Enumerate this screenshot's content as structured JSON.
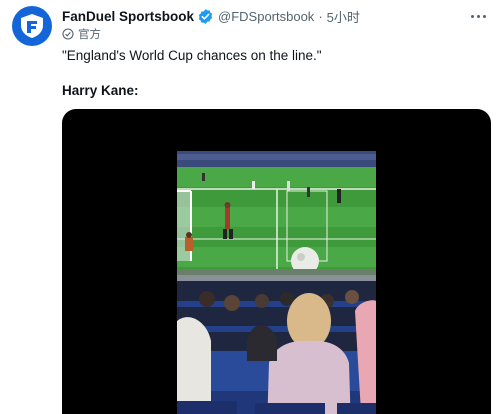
{
  "account": {
    "name": "FanDuel Sportsbook",
    "handle": "@FDSportsbook",
    "separator": "·",
    "time": "5小时",
    "label": "官方",
    "avatar_icon": "fanduel-shield-icon",
    "verified_icon": "verified-badge-icon",
    "accent": "#1d9bf0",
    "brand": "#1466d8"
  },
  "tweet": {
    "line1": "\"England's World Cup chances on the line.\"",
    "line2": "Harry Kane:"
  },
  "media": {
    "type": "video",
    "description_icon": "video-thumbnail"
  }
}
